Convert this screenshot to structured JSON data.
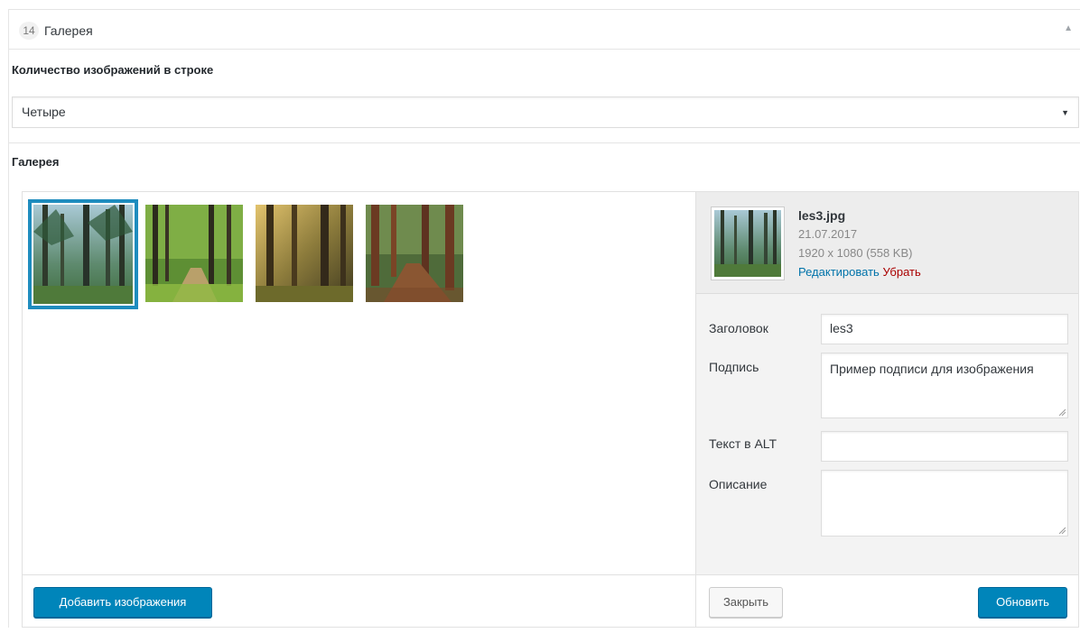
{
  "panel": {
    "number": "14",
    "title": "Галерея"
  },
  "fields": {
    "count_label": "Количество изображений в строке",
    "count_value": "Четыре",
    "gallery_label": "Галерея"
  },
  "gallery": {
    "images": [
      {
        "name": "forest-thumb-1",
        "selected": true
      },
      {
        "name": "forest-thumb-2",
        "selected": false
      },
      {
        "name": "forest-thumb-3",
        "selected": false
      },
      {
        "name": "forest-thumb-4",
        "selected": false
      }
    ],
    "add_button": "Добавить изображения"
  },
  "details": {
    "filename": "les3.jpg",
    "date": "21.07.2017",
    "size": "1920 x 1080 (558 KB)",
    "edit_link": "Редактировать",
    "remove_link": "Убрать",
    "title_label": "Заголовок",
    "title_value": "les3",
    "caption_label": "Подпись",
    "caption_value": "Пример подписи для изображения",
    "alt_label": "Текст в ALT",
    "alt_value": "",
    "description_label": "Описание",
    "description_value": "",
    "close_button": "Закрыть",
    "update_button": "Обновить"
  },
  "colors": {
    "accent": "#0085ba",
    "selected_border": "#1e8cbe",
    "remove": "#aa0000",
    "link": "#0073aa"
  }
}
